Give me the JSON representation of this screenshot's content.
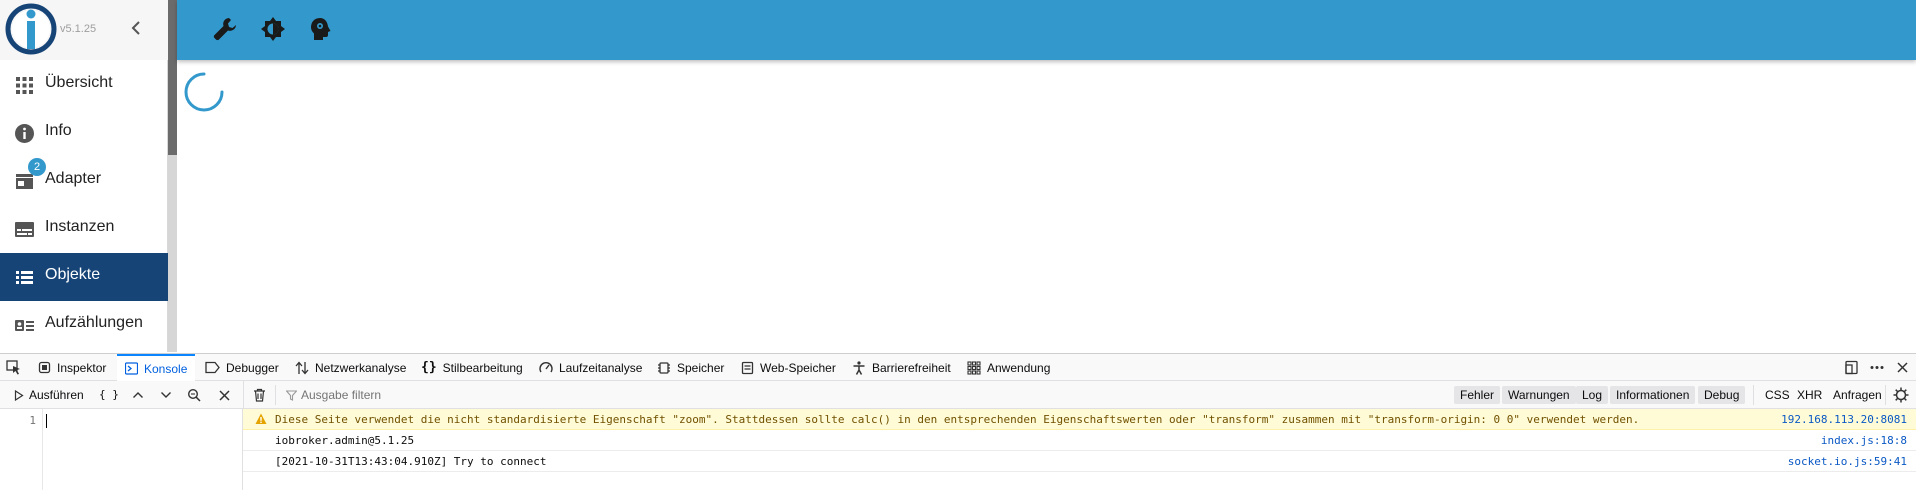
{
  "sidebar": {
    "version": "v5.1.25",
    "badge_count": "2",
    "items": [
      {
        "label": "Übersicht",
        "icon": "grid-icon"
      },
      {
        "label": "Info",
        "icon": "info-icon"
      },
      {
        "label": "Adapter",
        "icon": "store-icon"
      },
      {
        "label": "Instanzen",
        "icon": "instances-icon"
      },
      {
        "label": "Objekte",
        "icon": "list-icon",
        "active": true
      },
      {
        "label": "Aufzählungen",
        "icon": "enum-icon"
      }
    ]
  },
  "topbar": {
    "icons": [
      "wrench-icon",
      "brightness-icon",
      "expert-mode-icon"
    ],
    "accent": "#3399cc"
  },
  "devtools": {
    "tabs": [
      "Inspektor",
      "Konsole",
      "Debugger",
      "Netzwerkanalyse",
      "Stilbearbeitung",
      "Laufzeitanalyse",
      "Speicher",
      "Web-Speicher",
      "Barrierefreiheit",
      "Anwendung"
    ],
    "active_tab": "Konsole",
    "run_label": "Ausführen",
    "braces": "{ }",
    "filter_placeholder": "Ausgabe filtern",
    "filters": [
      "Fehler",
      "Warnungen",
      "Log",
      "Informationen",
      "Debug"
    ],
    "extra_filters": [
      "CSS",
      "XHR",
      "Anfragen"
    ],
    "line_number": "1",
    "messages": [
      {
        "type": "warning",
        "text": "Diese Seite verwendet die nicht standardisierte Eigenschaft \"zoom\". Stattdessen sollte calc() in den entsprechenden Eigenschaftswerten oder \"transform\" zusammen mit \"transform-origin: 0 0\" verwendet werden.",
        "source": "192.168.113.20:8081"
      },
      {
        "type": "log",
        "text": "iobroker.admin@5.1.25",
        "source": "index.js:18:8"
      },
      {
        "type": "log",
        "text": "[2021-10-31T13:43:04.910Z] Try to connect",
        "source": "socket.io.js:59:41"
      }
    ]
  }
}
